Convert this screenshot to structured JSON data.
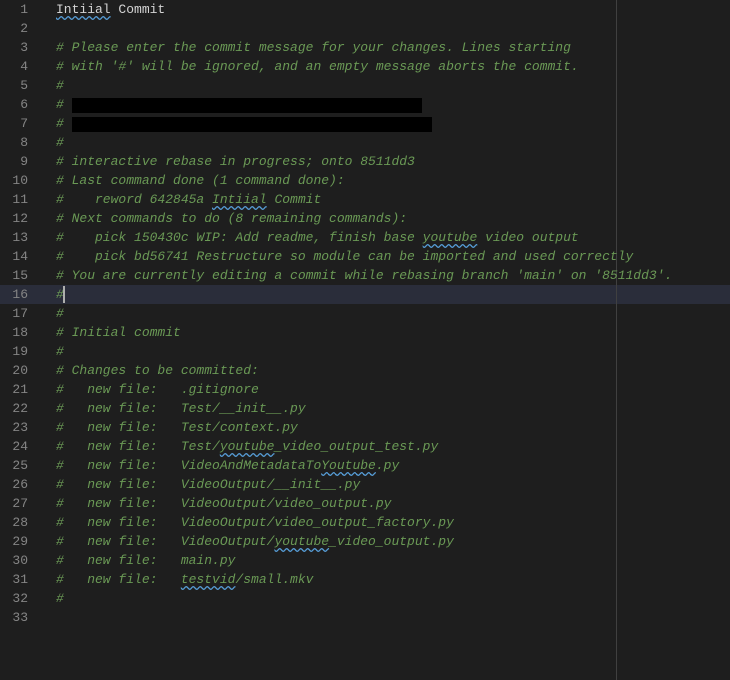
{
  "active_line": 16,
  "ruler_col": 80,
  "lines": [
    {
      "num": 1,
      "segs": [
        {
          "t": "Intiial",
          "cls": "fg typo"
        },
        {
          "t": " Commit",
          "cls": "fg"
        }
      ]
    },
    {
      "num": 2,
      "segs": []
    },
    {
      "num": 3,
      "segs": [
        {
          "t": "# Please enter the commit message for your changes. Lines starting",
          "cls": "comment"
        }
      ]
    },
    {
      "num": 4,
      "segs": [
        {
          "t": "# with '#' will be ignored, and an empty message aborts the commit.",
          "cls": "comment"
        }
      ]
    },
    {
      "num": 5,
      "segs": [
        {
          "t": "#",
          "cls": "comment"
        }
      ]
    },
    {
      "num": 6,
      "segs": [
        {
          "t": "# ",
          "cls": "comment"
        },
        {
          "redact": 350
        }
      ]
    },
    {
      "num": 7,
      "segs": [
        {
          "t": "# ",
          "cls": "comment"
        },
        {
          "redact": 360
        }
      ]
    },
    {
      "num": 8,
      "segs": [
        {
          "t": "#",
          "cls": "comment"
        }
      ]
    },
    {
      "num": 9,
      "segs": [
        {
          "t": "# interactive rebase in progress; onto 8511dd3",
          "cls": "comment"
        }
      ]
    },
    {
      "num": 10,
      "segs": [
        {
          "t": "# Last command done (1 command done):",
          "cls": "comment"
        }
      ]
    },
    {
      "num": 11,
      "segs": [
        {
          "t": "#    reword 642845a ",
          "cls": "comment"
        },
        {
          "t": "Intiial",
          "cls": "comment typo"
        },
        {
          "t": " Commit",
          "cls": "comment"
        }
      ]
    },
    {
      "num": 12,
      "segs": [
        {
          "t": "# Next commands to do (8 remaining commands):",
          "cls": "comment"
        }
      ]
    },
    {
      "num": 13,
      "segs": [
        {
          "t": "#    pick 150430c WIP: Add readme, finish base ",
          "cls": "comment"
        },
        {
          "t": "youtube",
          "cls": "comment typo"
        },
        {
          "t": " video output",
          "cls": "comment"
        }
      ]
    },
    {
      "num": 14,
      "segs": [
        {
          "t": "#    pick bd56741 Restructure so module can be imported and used correctly",
          "cls": "comment"
        }
      ]
    },
    {
      "num": 15,
      "segs": [
        {
          "t": "# You are currently editing a commit while rebasing branch 'main' on '8511dd3'.",
          "cls": "comment"
        }
      ]
    },
    {
      "num": 16,
      "segs": [
        {
          "t": "#",
          "cls": "comment"
        },
        {
          "cursor": true
        }
      ]
    },
    {
      "num": 17,
      "segs": [
        {
          "t": "#",
          "cls": "comment"
        }
      ]
    },
    {
      "num": 18,
      "segs": [
        {
          "t": "# Initial commit",
          "cls": "comment"
        }
      ]
    },
    {
      "num": 19,
      "segs": [
        {
          "t": "#",
          "cls": "comment"
        }
      ]
    },
    {
      "num": 20,
      "segs": [
        {
          "t": "# Changes to be committed:",
          "cls": "comment"
        }
      ]
    },
    {
      "num": 21,
      "segs": [
        {
          "t": "#   new file:   .gitignore",
          "cls": "comment"
        }
      ]
    },
    {
      "num": 22,
      "segs": [
        {
          "t": "#   new file:   Test/__init__.py",
          "cls": "comment"
        }
      ]
    },
    {
      "num": 23,
      "segs": [
        {
          "t": "#   new file:   Test/context.py",
          "cls": "comment"
        }
      ]
    },
    {
      "num": 24,
      "segs": [
        {
          "t": "#   new file:   Test/",
          "cls": "comment"
        },
        {
          "t": "youtube",
          "cls": "comment typo"
        },
        {
          "t": "_video_output_test.py",
          "cls": "comment"
        }
      ]
    },
    {
      "num": 25,
      "segs": [
        {
          "t": "#   new file:   VideoAndMetadataTo",
          "cls": "comment"
        },
        {
          "t": "Youtube",
          "cls": "comment typo"
        },
        {
          "t": ".py",
          "cls": "comment"
        }
      ]
    },
    {
      "num": 26,
      "segs": [
        {
          "t": "#   new file:   VideoOutput/__init__.py",
          "cls": "comment"
        }
      ]
    },
    {
      "num": 27,
      "segs": [
        {
          "t": "#   new file:   VideoOutput/video_output.py",
          "cls": "comment"
        }
      ]
    },
    {
      "num": 28,
      "segs": [
        {
          "t": "#   new file:   VideoOutput/video_output_factory.py",
          "cls": "comment"
        }
      ]
    },
    {
      "num": 29,
      "segs": [
        {
          "t": "#   new file:   VideoOutput/",
          "cls": "comment"
        },
        {
          "t": "youtube",
          "cls": "comment typo"
        },
        {
          "t": "_video_output.py",
          "cls": "comment"
        }
      ]
    },
    {
      "num": 30,
      "segs": [
        {
          "t": "#   new file:   main.py",
          "cls": "comment"
        }
      ]
    },
    {
      "num": 31,
      "segs": [
        {
          "t": "#   new file:   ",
          "cls": "comment"
        },
        {
          "t": "testvid",
          "cls": "comment typo"
        },
        {
          "t": "/small.mkv",
          "cls": "comment"
        }
      ]
    },
    {
      "num": 32,
      "segs": [
        {
          "t": "#",
          "cls": "comment"
        }
      ]
    },
    {
      "num": 33,
      "segs": []
    }
  ]
}
